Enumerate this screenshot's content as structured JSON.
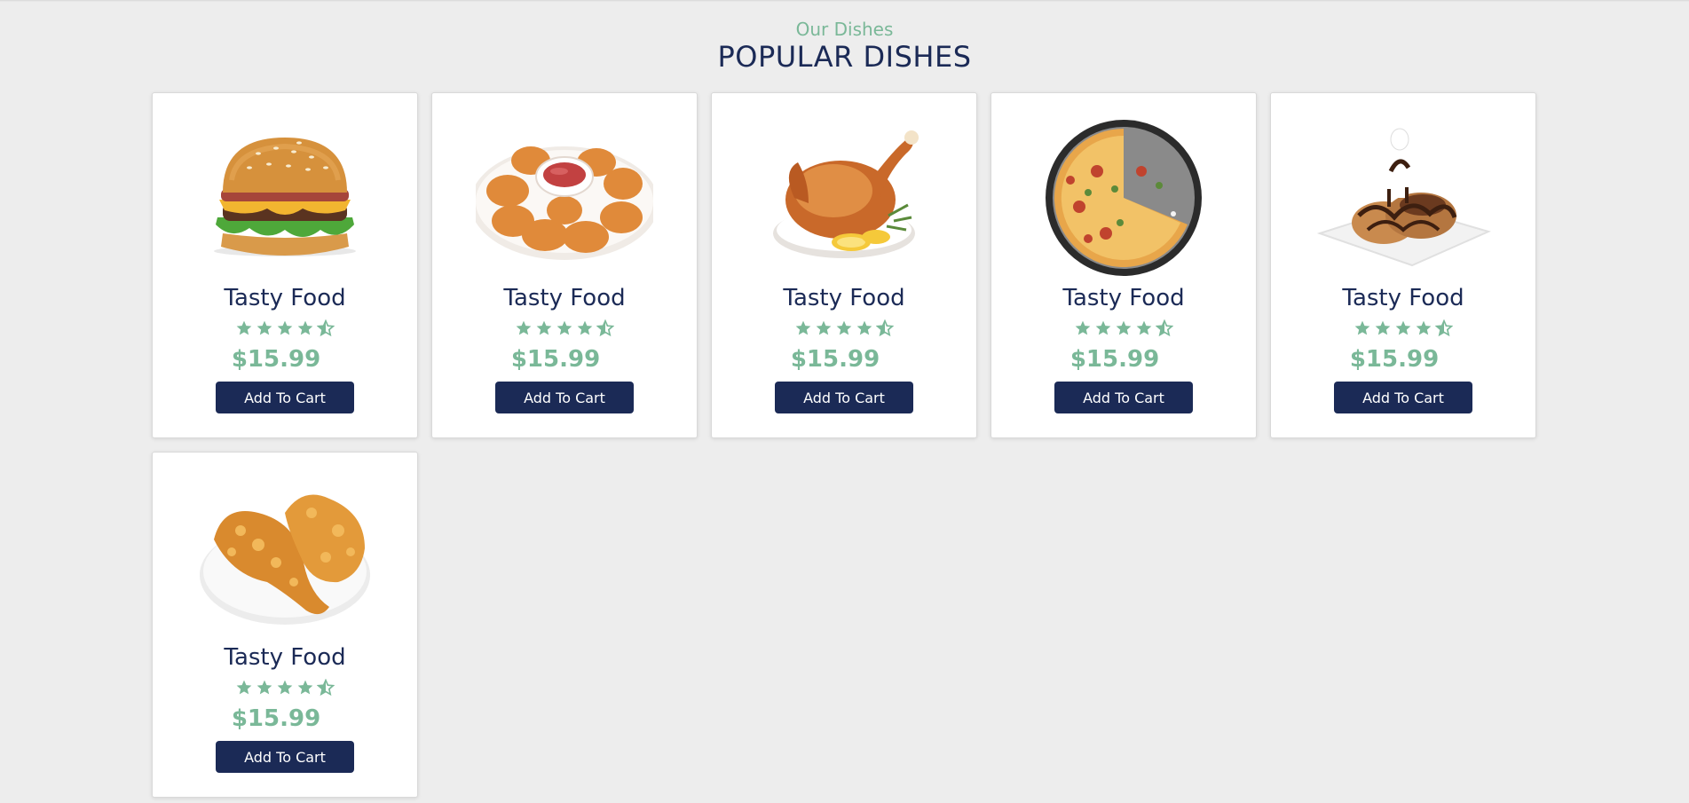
{
  "section": {
    "subtitle": "Our Dishes",
    "title": "POPULAR DISHES"
  },
  "colors": {
    "accent": "#7ab898",
    "navy": "#1b2a56",
    "background": "#ededed"
  },
  "dishes": [
    {
      "image": "burger-image",
      "name": "Tasty Food",
      "rating": 4.5,
      "price": "$15.99",
      "button": "Add To Cart"
    },
    {
      "image": "nuggets-image",
      "name": "Tasty Food",
      "rating": 4.5,
      "price": "$15.99",
      "button": "Add To Cart"
    },
    {
      "image": "roast-chicken-image",
      "name": "Tasty Food",
      "rating": 4.5,
      "price": "$15.99",
      "button": "Add To Cart"
    },
    {
      "image": "pizza-image",
      "name": "Tasty Food",
      "rating": 4.5,
      "price": "$15.99",
      "button": "Add To Cart"
    },
    {
      "image": "dessert-image",
      "name": "Tasty Food",
      "rating": 4.5,
      "price": "$15.99",
      "button": "Add To Cart"
    },
    {
      "image": "fried-chicken-image",
      "name": "Tasty Food",
      "rating": 4.5,
      "price": "$15.99",
      "button": "Add To Cart"
    }
  ]
}
